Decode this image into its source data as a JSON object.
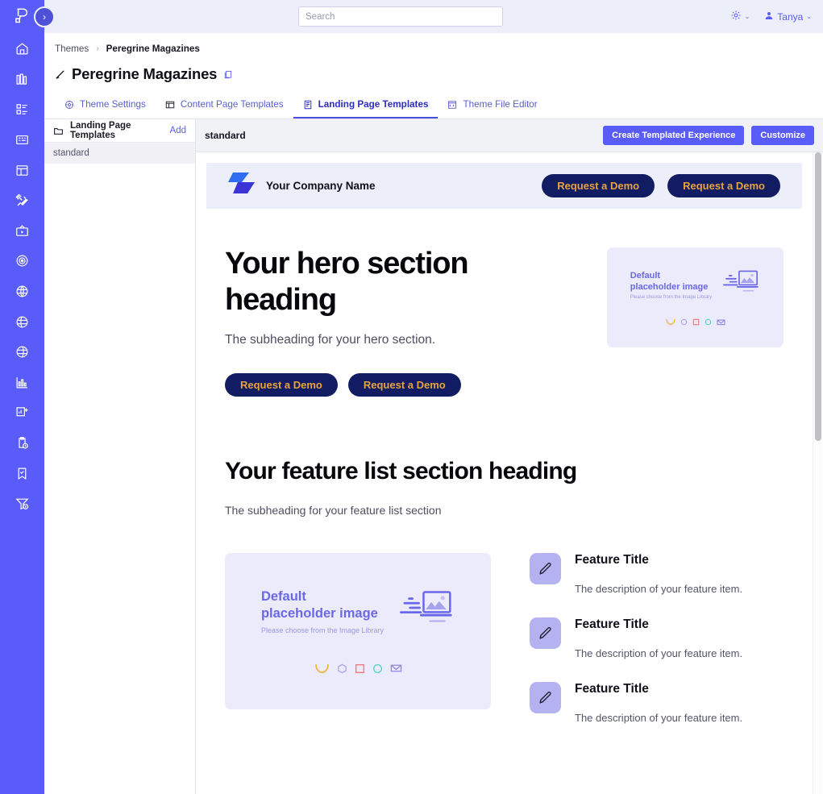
{
  "brand_colors": {
    "rail": "#5a5cfa",
    "accent": "#5a5cfa",
    "cta_bg": "#111c63",
    "cta_text": "#e8a33d",
    "placeholder_bg": "#ecebfb",
    "feature_icon_bg": "#b4b2f0"
  },
  "topbar": {
    "search_placeholder": "Search",
    "search_value": "",
    "settings_icon": "gear-icon",
    "user_name": "Tanya",
    "caret": "⌄"
  },
  "rail": {
    "logo_name": "product-logo",
    "toggle_glyph": "›",
    "items": [
      {
        "icon": "home-icon"
      },
      {
        "icon": "library-icon"
      },
      {
        "icon": "dashboard-icon"
      },
      {
        "icon": "form-icon"
      },
      {
        "icon": "page-layout-icon"
      },
      {
        "icon": "tools-icon"
      },
      {
        "icon": "media-icon"
      },
      {
        "icon": "target-icon"
      },
      {
        "icon": "globe-icon"
      },
      {
        "icon": "globe-alt-icon"
      },
      {
        "icon": "globe-alt2-icon"
      },
      {
        "icon": "analytics-icon"
      },
      {
        "icon": "report-add-icon"
      },
      {
        "icon": "clipboard-clock-icon"
      },
      {
        "icon": "bookmark-check-icon"
      },
      {
        "icon": "funnel-dollar-icon"
      }
    ]
  },
  "breadcrumb": {
    "root": "Themes",
    "separator": "›",
    "current": "Peregrine Magazines"
  },
  "page": {
    "title": "Peregrine Magazines",
    "edit_icon": "pencil-icon",
    "copy_icon": "copy-icon"
  },
  "tabs": [
    {
      "label": "Theme Settings",
      "icon": "settings-gear-icon",
      "active": false
    },
    {
      "label": "Content Page Templates",
      "icon": "content-page-icon",
      "active": false
    },
    {
      "label": "Landing Page Templates",
      "icon": "landing-page-icon",
      "active": true
    },
    {
      "label": "Theme File Editor",
      "icon": "file-editor-icon",
      "active": false
    }
  ],
  "list_panel": {
    "folder_icon": "folder-icon",
    "title": "Landing Page Templates",
    "add_label": "Add",
    "items": [
      {
        "label": "standard",
        "selected": true
      }
    ]
  },
  "preview_header": {
    "name": "standard",
    "create_label": "Create Templated Experience",
    "customize_label": "Customize"
  },
  "preview": {
    "site_header": {
      "logo_name": "company-logo",
      "company_name": "Your Company Name",
      "cta_primary": "Request a Demo",
      "cta_secondary": "Request a Demo"
    },
    "hero": {
      "heading": "Your hero section heading",
      "subheading": "The subheading for your hero section.",
      "cta_primary": "Request a Demo",
      "cta_secondary": "Request a Demo",
      "image": {
        "title": "Default placeholder image",
        "title_line1": "Default",
        "title_line2": "placeholder image",
        "caption": "Please choose from the Image Library"
      }
    },
    "feature_section": {
      "heading": "Your feature list section heading",
      "subheading": "The subheading for your feature list section",
      "image": {
        "title_line1": "Default",
        "title_line2": "placeholder image",
        "caption": "Please choose from the Image Library"
      },
      "items": [
        {
          "icon": "pencil-icon",
          "title": "Feature Title",
          "description": "The description of your feature item."
        },
        {
          "icon": "pencil-icon",
          "title": "Feature Title",
          "description": "The description of your feature item."
        },
        {
          "icon": "pencil-icon",
          "title": "Feature Title",
          "description": "The description of your feature item."
        }
      ]
    }
  },
  "scrollbar": {
    "thumb_top_pct": 0,
    "thumb_height_pct": 45
  }
}
